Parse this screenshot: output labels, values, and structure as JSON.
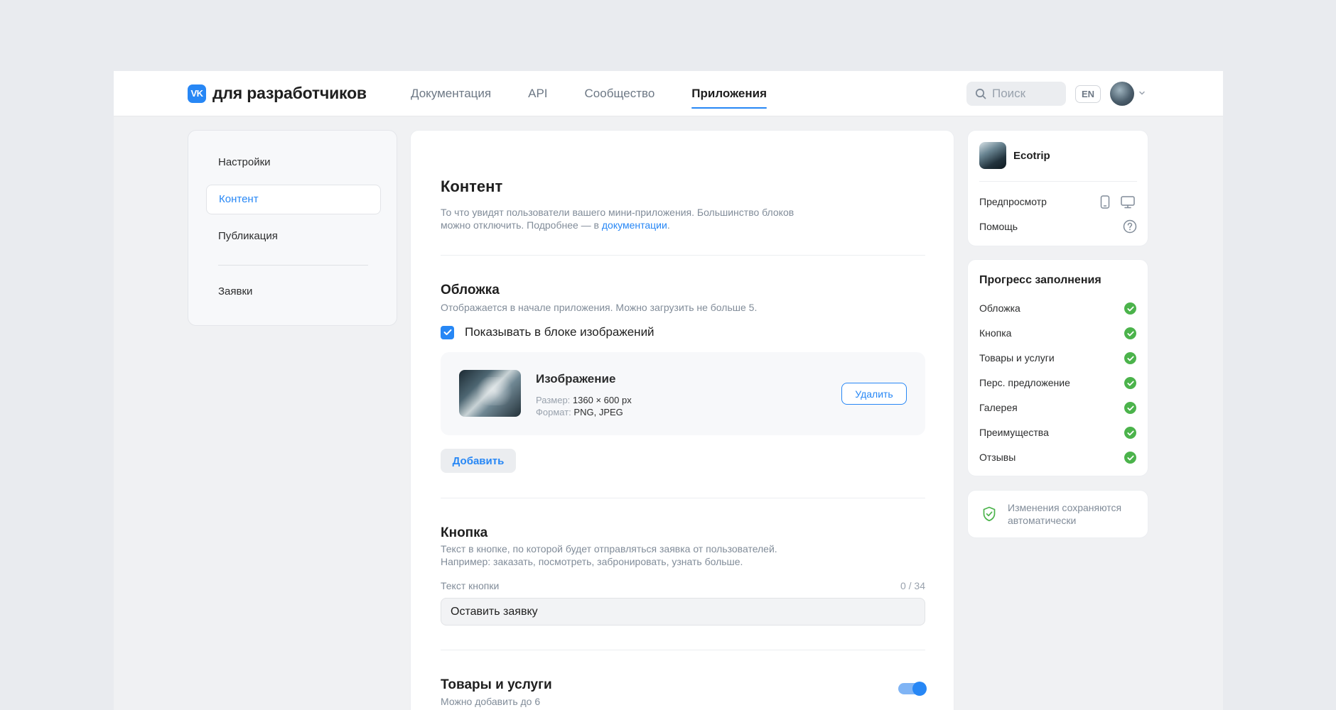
{
  "header": {
    "logo_mark": "VK",
    "logo_text": "для разработчиков",
    "nav": [
      {
        "label": "Документация"
      },
      {
        "label": "API"
      },
      {
        "label": "Сообщество"
      },
      {
        "label": "Приложения",
        "active": true
      }
    ],
    "search_placeholder": "Поиск",
    "lang": "EN"
  },
  "sidebar": {
    "items": [
      {
        "label": "Настройки"
      },
      {
        "label": "Контент",
        "active": true
      },
      {
        "label": "Публикация"
      },
      {
        "label": "Заявки"
      }
    ]
  },
  "main": {
    "title": "Контент",
    "description_line1": "То что увидят пользователи вашего мини-приложения. Большинство блоков",
    "description_line2_prefix": "можно отключить. Подробнее — в ",
    "description_link": "документации",
    "description_suffix": ".",
    "cover": {
      "title": "Обложка",
      "hint": "Отображается в начале приложения. Можно загрузить не больше 5.",
      "checkbox_label": "Показывать в блоке изображений",
      "checkbox_checked": true,
      "image": {
        "title": "Изображение",
        "size_label": "Размер:",
        "size_value": "1360 × 600 px",
        "format_label": "Формат:",
        "format_value": "PNG, JPEG",
        "delete_label": "Удалить"
      },
      "add_label": "Добавить"
    },
    "button_section": {
      "title": "Кнопка",
      "hint_line1": "Текст в кнопке, по которой будет отправляться заявка от пользователей.",
      "hint_line2": "Например: заказать, посмотреть, забронировать, узнать больше.",
      "field_label": "Текст кнопки",
      "counter": "0 / 34",
      "value": "Оставить заявку"
    },
    "goods": {
      "title": "Товары и услуги",
      "hint": "Можно добавить до 6",
      "enabled": true
    }
  },
  "app_card": {
    "name": "Ecotrip",
    "preview_label": "Предпросмотр",
    "help_label": "Помощь"
  },
  "progress": {
    "title": "Прогресс заполнения",
    "items": [
      {
        "label": "Обложка",
        "done": true
      },
      {
        "label": "Кнопка",
        "done": true
      },
      {
        "label": "Товары и услуги",
        "done": true
      },
      {
        "label": "Перс. предложение",
        "done": true
      },
      {
        "label": "Галерея",
        "done": true
      },
      {
        "label": "Преимущества",
        "done": true
      },
      {
        "label": "Отзывы",
        "done": true
      }
    ]
  },
  "autosave": {
    "line1": "Изменения сохраняются",
    "line2": "автоматически"
  },
  "colors": {
    "accent": "#2787f5",
    "success": "#4bb34b",
    "page_bg": "#e9ebef"
  }
}
